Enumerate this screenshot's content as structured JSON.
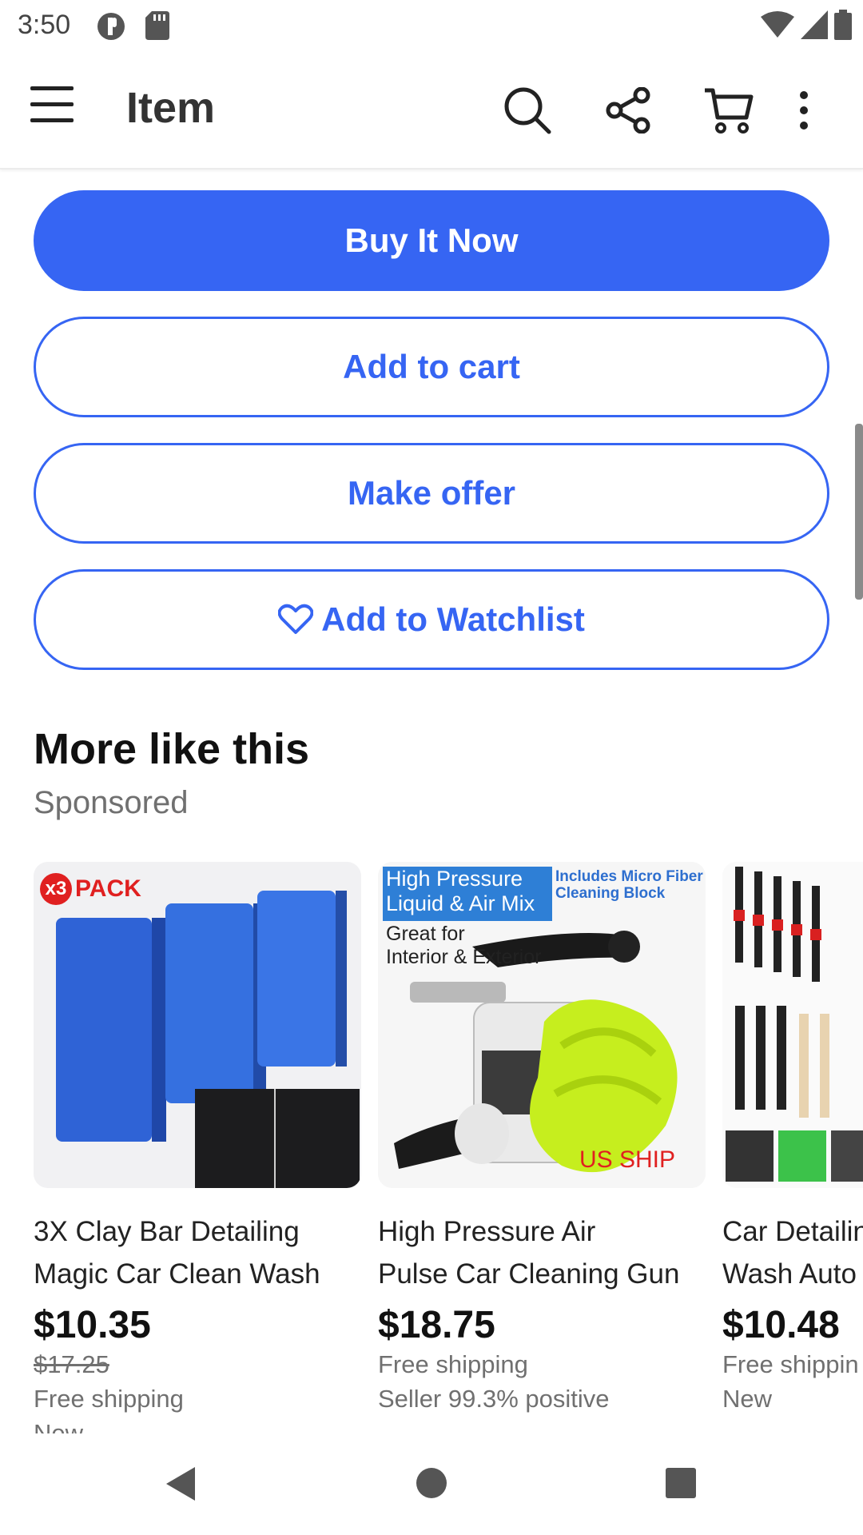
{
  "status": {
    "time": "3:50"
  },
  "appbar": {
    "title": "Item"
  },
  "actions": {
    "buy_now": "Buy It Now",
    "add_to_cart": "Add to cart",
    "make_offer": "Make offer",
    "watchlist": "Add to Watchlist"
  },
  "section": {
    "title": "More like this",
    "subtitle": "Sponsored"
  },
  "products": [
    {
      "title_line1": "3X Clay Bar Detailing",
      "title_line2": "Magic Car Clean Wash",
      "price": "$10.35",
      "original_price": "$17.25",
      "shipping": "Free shipping",
      "condition": "New",
      "image_badge": "x3",
      "image_badge_text": "PACK"
    },
    {
      "title_line1": "High Pressure Air",
      "title_line2": "Pulse Car Cleaning Gun",
      "price": "$18.75",
      "shipping": "Free shipping",
      "seller": "Seller 99.3% positive",
      "image_text1": "High Pressure",
      "image_text2": "Liquid & Air Mix",
      "image_text3": "Includes Micro Fiber Cleaning Block",
      "image_text4": "Great for",
      "image_text5": "Interior & Exterior",
      "image_text6": "US SHIP"
    },
    {
      "title_line1": "Car Detailin",
      "title_line2": "Wash Auto",
      "price": "$10.48",
      "shipping": "Free shippin",
      "condition": "New"
    }
  ],
  "colors": {
    "accent": "#3665f3",
    "text": "#191919",
    "muted": "#707070"
  }
}
